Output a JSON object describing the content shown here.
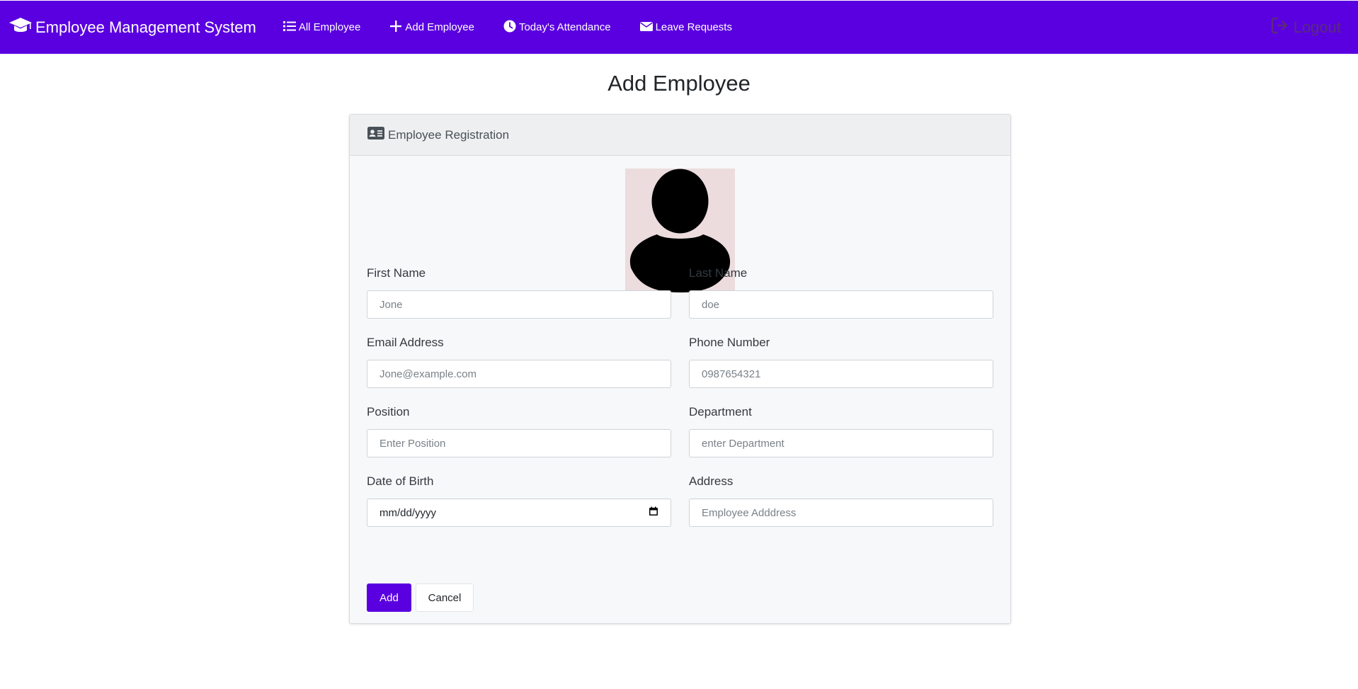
{
  "navbar": {
    "brand": "Employee Management System",
    "brand_icon": "graduation-cap-icon",
    "items": [
      {
        "label": "All Employee",
        "icon": "list-icon"
      },
      {
        "label": "Add Employee",
        "icon": "plus-icon"
      },
      {
        "label": "Today's Attendance",
        "icon": "clock-icon"
      },
      {
        "label": "Leave Requests",
        "icon": "envelope-icon"
      }
    ],
    "logout_label": "Logout",
    "logout_icon": "sign-out-icon",
    "background_color": "#5a00e0"
  },
  "page_title": "Add Employee",
  "card": {
    "header": "Employee Registration",
    "header_icon": "id-card-icon",
    "avatar_icon": "user-silhouette-icon"
  },
  "form": {
    "first_name": {
      "label": "First Name",
      "placeholder": "Jone"
    },
    "last_name": {
      "label": "Last Name",
      "placeholder": "doe"
    },
    "email": {
      "label": "Email Address",
      "placeholder": "Jone@example.com"
    },
    "phone": {
      "label": "Phone Number",
      "placeholder": "0987654321"
    },
    "position": {
      "label": "Position",
      "placeholder": "Enter Position"
    },
    "department": {
      "label": "Department",
      "placeholder": "enter Department"
    },
    "dob": {
      "label": "Date of Birth",
      "value": "mm/dd/yyyy"
    },
    "address": {
      "label": "Address",
      "placeholder": "Employee Adddress"
    }
  },
  "buttons": {
    "add": "Add",
    "cancel": "Cancel",
    "primary_color": "#5a00e0"
  }
}
